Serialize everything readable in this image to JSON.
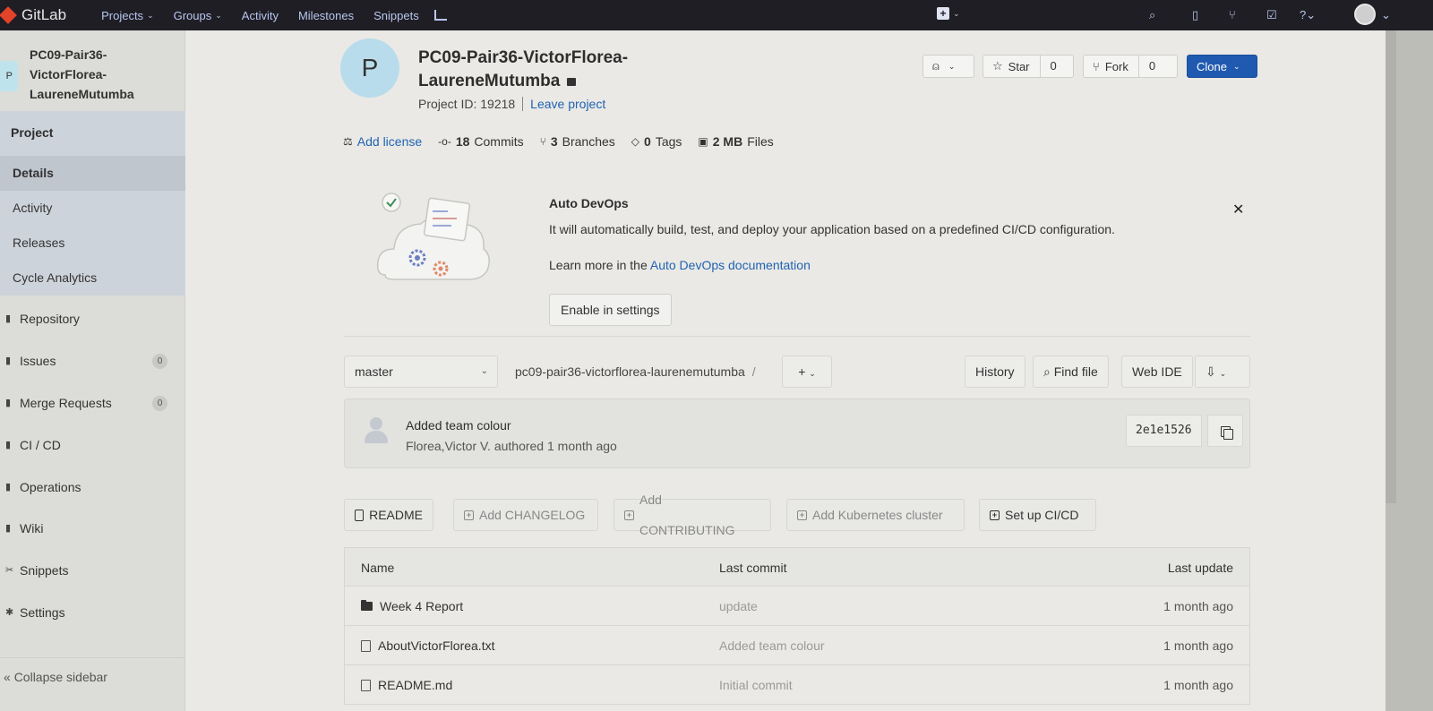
{
  "topbar": {
    "brand": "GitLab",
    "nav": [
      {
        "label": "Projects",
        "dropdown": true
      },
      {
        "label": "Groups",
        "dropdown": true
      },
      {
        "label": "Activity",
        "dropdown": false
      },
      {
        "label": "Milestones",
        "dropdown": false
      },
      {
        "label": "Snippets",
        "dropdown": false
      }
    ],
    "icons": [
      "chart-icon",
      "plus-icon",
      "search-icon",
      "issues-icon",
      "merge-request-icon",
      "todo-icon",
      "help-icon",
      "avatar"
    ]
  },
  "sidebar": {
    "avatar_letter": "P",
    "project_name": "PC09-Pair36-VictorFlorea-LaureneMutumba",
    "section": "Project",
    "sub_items": [
      "Details",
      "Activity",
      "Releases",
      "Cycle Analytics"
    ],
    "active_sub": "Details",
    "items": [
      {
        "label": "Repository",
        "icon": "book-icon"
      },
      {
        "label": "Issues",
        "icon": "issues-icon",
        "badge": "0"
      },
      {
        "label": "Merge Requests",
        "icon": "merge-request-icon",
        "badge": "0"
      },
      {
        "label": "CI / CD",
        "icon": "rocket-icon"
      },
      {
        "label": "Operations",
        "icon": "cloud-icon"
      },
      {
        "label": "Wiki",
        "icon": "wiki-icon"
      },
      {
        "label": "Snippets",
        "icon": "scissors-icon"
      },
      {
        "label": "Settings",
        "icon": "gear-icon"
      }
    ],
    "collapse": "Collapse sidebar"
  },
  "project": {
    "avatar_letter": "P",
    "title_line1": "PC09-Pair36-VictorFlorea-",
    "title_line2": "LaureneMutumba",
    "id_label": "Project ID: 19218",
    "leave": "Leave project",
    "notif_label": "",
    "star_label": "Star",
    "star_count": "0",
    "fork_label": "Fork",
    "fork_count": "0",
    "clone_label": "Clone"
  },
  "stats": {
    "license": "Add license",
    "commits_num": "18",
    "commits_label": "Commits",
    "branches_num": "3",
    "branches_label": "Branches",
    "tags_num": "0",
    "tags_label": "Tags",
    "files_num": "2 MB",
    "files_label": "Files"
  },
  "devops": {
    "title": "Auto DevOps",
    "description": "It will automatically build, test, and deploy your application based on a predefined CI/CD configuration.",
    "more_prefix": "Learn more in the",
    "more_link": "Auto DevOps documentation",
    "enable": "Enable in settings"
  },
  "repo": {
    "branch": "master",
    "path": "pc09-pair36-victorflorea-laurenemutumba",
    "slash": "/",
    "add": "+",
    "history": "History",
    "find_file": "Find file",
    "web_ide": "Web IDE"
  },
  "last_commit": {
    "message": "Added team colour",
    "author_line": "Florea,Victor V. authored 1 month ago",
    "sha": "2e1e1526"
  },
  "quick_actions": [
    {
      "label": "README",
      "style": "file"
    },
    {
      "label": "Add CHANGELOG",
      "style": "add"
    },
    {
      "label": "Add CONTRIBUTING",
      "style": "add"
    },
    {
      "label": "Add Kubernetes cluster",
      "style": "add"
    },
    {
      "label": "Set up CI/CD",
      "style": "add-solid"
    }
  ],
  "files": {
    "headers": {
      "name": "Name",
      "last_commit": "Last commit",
      "last_update": "Last update"
    },
    "rows": [
      {
        "name": "Week 4 Report",
        "type": "folder",
        "commit": "update",
        "updated": "1 month ago"
      },
      {
        "name": "AboutVictorFlorea.txt",
        "type": "file",
        "commit": "Added team colour",
        "updated": "1 month ago"
      },
      {
        "name": "README.md",
        "type": "file",
        "commit": "Initial commit",
        "updated": "1 month ago"
      }
    ]
  },
  "colors": {
    "topbar": "#1f1e24",
    "link": "#1f63b3",
    "primary": "#1f5ab0",
    "sidebar_active": "#cdd3da"
  }
}
